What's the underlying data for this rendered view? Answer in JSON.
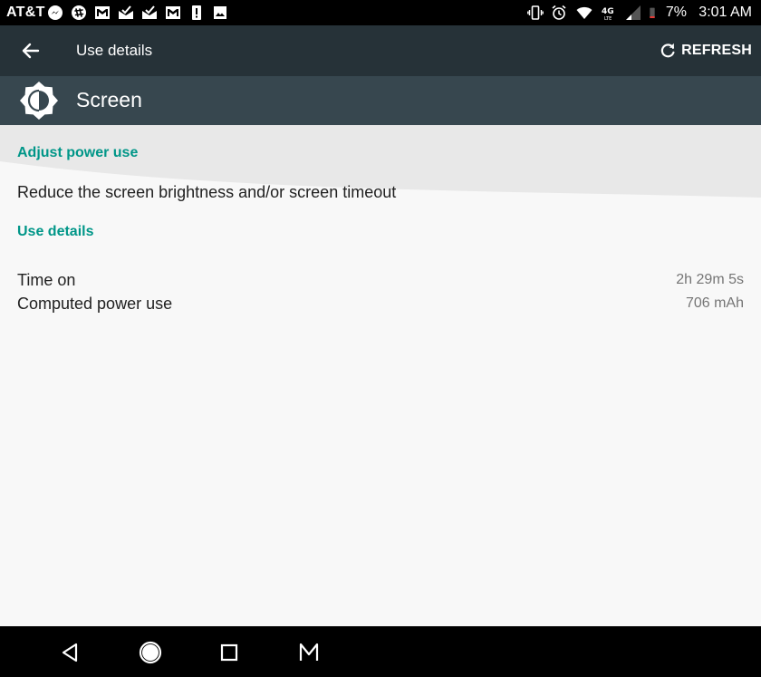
{
  "status_bar": {
    "carrier": "AT&T",
    "battery_percent": "7%",
    "time": "3:01 AM",
    "left_icons": [
      "messenger-icon",
      "slack-icon",
      "gmail-icon",
      "mail-check-icon",
      "mail-check-icon",
      "gmail-icon",
      "alert-icon",
      "image-icon"
    ],
    "right_icons": [
      "vibrate-icon",
      "alarm-icon",
      "wifi-icon",
      "lte-icon",
      "signal-icon",
      "battery-low-icon"
    ]
  },
  "app_bar": {
    "title": "Use details",
    "refresh_label": "REFRESH",
    "background": "#263238"
  },
  "header": {
    "title": "Screen",
    "icon": "brightness-icon",
    "background": "#37474f"
  },
  "adjust_section": {
    "label": "Adjust power use",
    "text": "Reduce the screen brightness and/or screen timeout"
  },
  "details_section": {
    "label": "Use details",
    "rows": [
      {
        "label": "Time on",
        "value": "2h 29m 5s"
      },
      {
        "label": "Computed power use",
        "value": "706 mAh"
      }
    ]
  },
  "colors": {
    "accent": "#009688",
    "background": "#f8f8f8"
  },
  "nav_bar": {
    "buttons": [
      "back-icon",
      "home-icon",
      "recents-icon",
      "m-icon"
    ]
  }
}
